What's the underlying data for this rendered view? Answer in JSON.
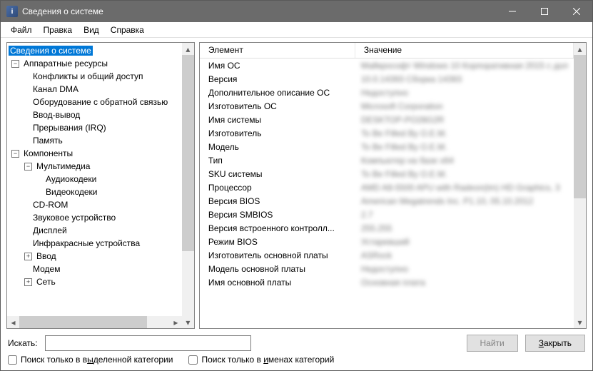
{
  "window": {
    "title": "Сведения о системе"
  },
  "menu": {
    "file": "Файл",
    "edit": "Правка",
    "view": "Вид",
    "help": "Справка"
  },
  "tree": {
    "root": "Сведения о системе",
    "hw": "Аппаратные ресурсы",
    "hw_items": {
      "conflicts": "Конфликты и общий доступ",
      "dma": "Канал DMA",
      "feedback": "Оборудование с обратной связью",
      "io": "Ввод-вывод",
      "irq": "Прерывания (IRQ)",
      "memory": "Память"
    },
    "components": "Компоненты",
    "multimedia": "Мультимедиа",
    "mm_items": {
      "audio": "Аудиокодеки",
      "video": "Видеокодеки"
    },
    "comp_items": {
      "cdrom": "CD-ROM",
      "sound": "Звуковое устройство",
      "display": "Дисплей",
      "infrared": "Инфракрасные устройства",
      "input": "Ввод",
      "modem": "Модем",
      "network": "Сеть"
    }
  },
  "table": {
    "header_element": "Элемент",
    "header_value": "Значение",
    "rows": [
      {
        "name": "Имя ОС",
        "value": "Майкрософт Windows 10 Корпоративная 2015 с дол"
      },
      {
        "name": "Версия",
        "value": "10.0.14393 Сборка 14393"
      },
      {
        "name": "Дополнительное описание ОС",
        "value": "Недоступно"
      },
      {
        "name": "Изготовитель ОС",
        "value": "Microsoft Corporation"
      },
      {
        "name": "Имя системы",
        "value": "DESKTOP-PO28G2R"
      },
      {
        "name": "Изготовитель",
        "value": "To Be Filled By O.E.M."
      },
      {
        "name": "Модель",
        "value": "To Be Filled By O.E.M."
      },
      {
        "name": "Тип",
        "value": "Компьютер на базе x64"
      },
      {
        "name": "SKU системы",
        "value": "To Be Filled By O.E.M."
      },
      {
        "name": "Процессор",
        "value": "AMD A8-5500 APU with Radeon(tm) HD Graphics, 3"
      },
      {
        "name": "Версия BIOS",
        "value": "American Megatrends Inc. P1.10, 05.10.2012"
      },
      {
        "name": "Версия SMBIOS",
        "value": "2.7"
      },
      {
        "name": "Версия встроенного контролл...",
        "value": "255.255"
      },
      {
        "name": "Режим BIOS",
        "value": "Устаревший"
      },
      {
        "name": "Изготовитель основной платы",
        "value": "ASRock"
      },
      {
        "name": "Модель основной платы",
        "value": "Недоступно"
      },
      {
        "name": "Имя основной платы",
        "value": "Основная плата"
      }
    ]
  },
  "search": {
    "label": "Искать:",
    "value": "",
    "find_label": "Найти",
    "close_prefix": "З",
    "close_rest": "акрыть"
  },
  "checks": {
    "selected_only_pre": "Поиск только в в",
    "selected_only_accel": "ы",
    "selected_only_post": "деленной категории",
    "names_only_pre": "Поиск только в ",
    "names_only_accel": "и",
    "names_only_post": "менах категорий"
  }
}
